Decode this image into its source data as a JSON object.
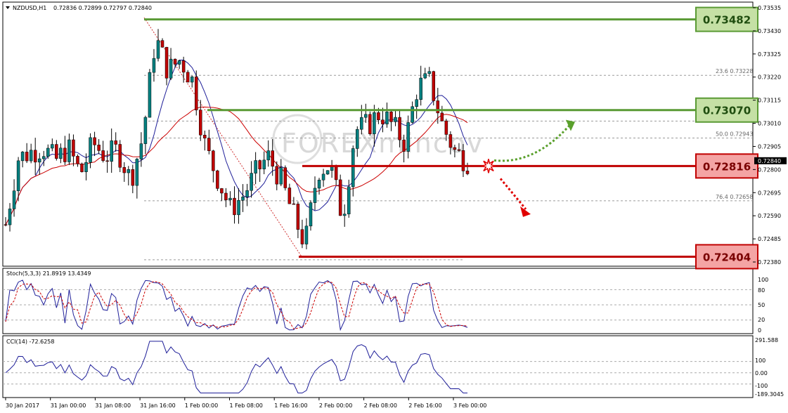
{
  "header": {
    "symbol": "NZDUSD,H1",
    "ohlc": "0.72836 0.72899 0.72797 0.72840"
  },
  "watermark": "FOREXmincov",
  "levels": [
    {
      "label": "0.73482",
      "value": 0.73482,
      "kind": "resistance",
      "color": "#70ad47"
    },
    {
      "label": "0.73070",
      "value": 0.7307,
      "kind": "resistance",
      "color": "#70ad47"
    },
    {
      "label": "0.72816",
      "value": 0.72816,
      "kind": "support",
      "color": "#c00000"
    },
    {
      "label": "0.72404",
      "value": 0.72404,
      "kind": "support",
      "color": "#c00000"
    }
  ],
  "fib": [
    {
      "label": "23.6  0.73228",
      "value": 0.73228
    },
    {
      "label": "50.0  0.72943",
      "value": 0.72943
    },
    {
      "label": "76.4  0.72658",
      "value": 0.72658
    }
  ],
  "current_price": "0.72840",
  "price_ticks": [
    "0.73535",
    "0.73430",
    "0.73325",
    "0.73220",
    "0.73115",
    "0.73010",
    "0.72905",
    "0.72800",
    "0.72695",
    "0.72590",
    "0.72485",
    "0.72380"
  ],
  "time_ticks": [
    "30 Jan 2017",
    "31 Jan 00:00",
    "31 Jan 08:00",
    "31 Jan 16:00",
    "1 Feb 00:00",
    "1 Feb 08:00",
    "1 Feb 16:00",
    "2 Feb 00:00",
    "2 Feb 08:00",
    "2 Feb 16:00",
    "3 Feb 00:00"
  ],
  "stoch": {
    "label": "Stoch(5,3,3) 21.8919 13.4349",
    "ticks": [
      "100",
      "80",
      "50",
      "20",
      "0"
    ]
  },
  "cci": {
    "label": "CCI(14) -72.6258",
    "ticks": [
      "291.588",
      "100",
      "0.00",
      "-100",
      "-189.3045"
    ]
  },
  "colors": {
    "bull": "#008080",
    "bear": "#c00000",
    "ma_fast": "#1f1f99",
    "ma_slow": "#cc0000",
    "arrow_up": "#5aa02c",
    "arrow_down": "#e00000"
  },
  "chart_data": {
    "type": "candlestick",
    "symbol": "NZDUSD",
    "timeframe": "H1",
    "ylim": [
      0.7233,
      0.7355
    ],
    "x": [
      "30 Jan 2017",
      "31 Jan 00:00",
      "31 Jan 08:00",
      "31 Jan 16:00",
      "1 Feb 00:00",
      "1 Feb 08:00",
      "1 Feb 16:00",
      "2 Feb 00:00",
      "2 Feb 08:00",
      "2 Feb 16:00",
      "3 Feb 00:00"
    ],
    "close_path": [
      0.7255,
      0.7285,
      0.7288,
      0.729,
      0.7284,
      0.729,
      0.7278,
      0.7292,
      0.7286,
      0.7289,
      0.7275,
      0.7295,
      0.734,
      0.7325,
      0.733,
      0.732,
      0.729,
      0.7276,
      0.7262,
      0.7268,
      0.7278,
      0.7286,
      0.7276,
      0.726,
      0.7246,
      0.728,
      0.7282,
      0.7258,
      0.7298,
      0.73,
      0.7306,
      0.73,
      0.7292,
      0.7318,
      0.732,
      0.73,
      0.7288,
      0.7284
    ],
    "series": [
      {
        "name": "NZDUSD,H1",
        "kind": "price"
      },
      {
        "kind": "moving average (blue)"
      },
      {
        "kind": "moving average (red)"
      }
    ],
    "levels": [
      0.73482,
      0.7307,
      0.72816,
      0.72404
    ],
    "fibonacci": {
      "23.6": 0.73228,
      "50.0": 0.72943,
      "76.4": 0.72658
    }
  }
}
